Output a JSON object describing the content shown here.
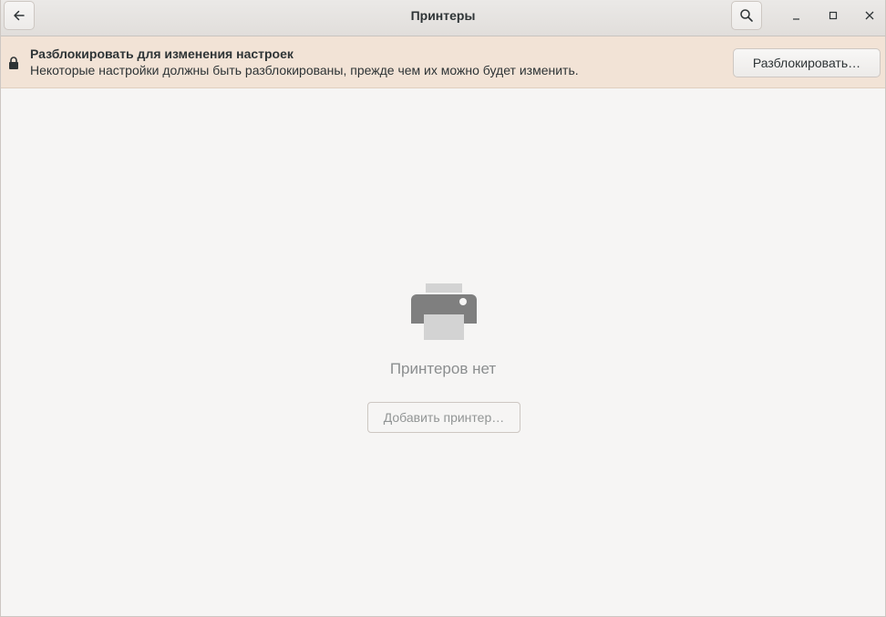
{
  "window": {
    "title": "Принтеры"
  },
  "headerbar": {
    "back_icon": "arrow-left-icon",
    "search_icon": "search-icon",
    "minimize_icon": "minimize-icon",
    "maximize_icon": "maximize-icon",
    "close_icon": "close-icon"
  },
  "infobar": {
    "title": "Разблокировать для изменения настроек",
    "text": "Некоторые настройки должны быть разблокированы, прежде чем их можно будет изменить.",
    "unlock_label": "Разблокировать…",
    "icon": "lock-icon",
    "background": "#f2e3d6"
  },
  "empty_state": {
    "icon": "printer-icon",
    "label": "Принтеров нет",
    "add_button_label": "Добавить принтер…"
  }
}
